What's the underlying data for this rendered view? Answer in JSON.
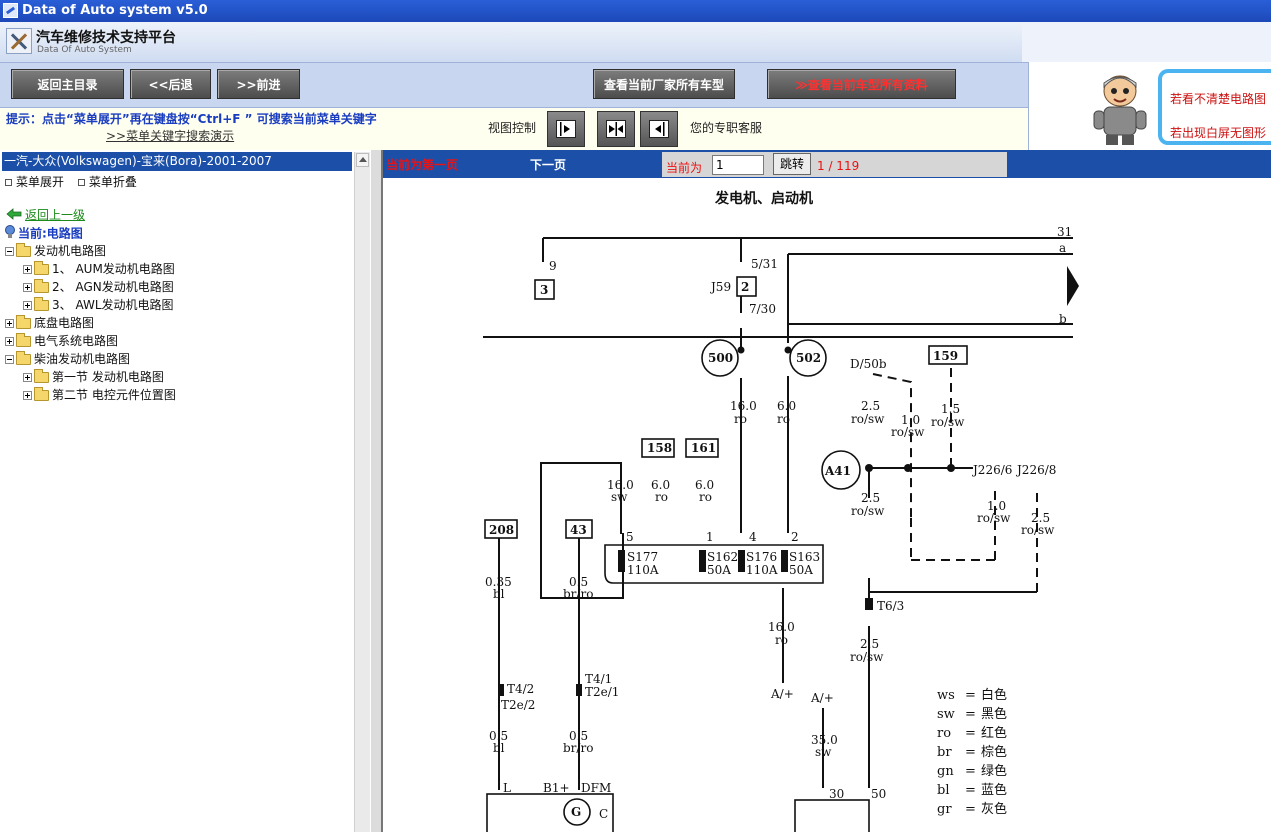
{
  "window": {
    "title": "Data of Auto system v5.0"
  },
  "brand": {
    "name": "汽车维修技术支持平台",
    "subtitle": "Data Of Auto System"
  },
  "toolbar": {
    "main_menu": "返回主目录",
    "back": "<<后退",
    "forward": ">>前进",
    "current_models": "查看当前厂家所有车型",
    "all_data": "≫查看当前车型所有资料"
  },
  "hint": {
    "text": "提示：点击“菜单展开”再在键盘按“Ctrl+F ” 可搜索当前菜单关键字",
    "demo_link": ">>菜单关键字搜索演示",
    "view_control": "视图控制",
    "service": "您的专职客服"
  },
  "ad": {
    "line1": "若看不清楚电路图",
    "line2": "若出现白屏无图形"
  },
  "sidebar": {
    "model": "一汽-大众(Volkswagen)-宝来(Bora)-2001-2007",
    "expand": "菜单展开",
    "collapse": "菜单折叠",
    "back_up": "返回上一级",
    "current": "当前:电路图",
    "items": [
      {
        "label": "发动机电路图"
      },
      {
        "label": "1、 AUM发动机电路图"
      },
      {
        "label": "2、 AGN发动机电路图"
      },
      {
        "label": "3、 AWL发动机电路图"
      },
      {
        "label": "底盘电路图"
      },
      {
        "label": "电气系统电路图"
      },
      {
        "label": "柴油发动机电路图"
      },
      {
        "label": "第一节 发动机电路图"
      },
      {
        "label": "第二节 电控元件位置图"
      }
    ]
  },
  "pager": {
    "first": "当前为第一页",
    "next": "下一页",
    "current_label": "当前为",
    "page_value": "1",
    "go": "跳转",
    "total": "1 / 119"
  },
  "diagram": {
    "title": "发电机、启动机",
    "legend": [
      {
        "code": "ws",
        "name": "白色"
      },
      {
        "code": "sw",
        "name": "黑色"
      },
      {
        "code": "ro",
        "name": "红色"
      },
      {
        "code": "br",
        "name": "棕色"
      },
      {
        "code": "gn",
        "name": "绿色"
      },
      {
        "code": "bl",
        "name": "蓝色"
      },
      {
        "code": "gr",
        "name": "灰色"
      }
    ]
  },
  "colors": {
    "titlebar": "#1c48b8",
    "nav": "#1b4fa8",
    "alert": "#e11111",
    "hint": "#1a3dc0"
  }
}
